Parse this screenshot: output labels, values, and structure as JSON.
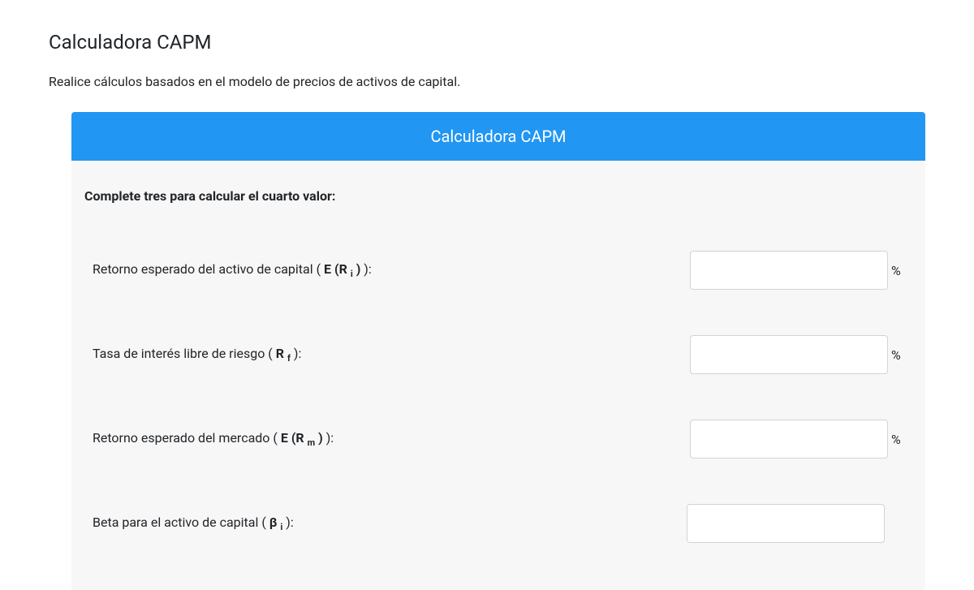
{
  "page": {
    "title": "Calculadora CAPM",
    "description": "Realice cálculos basados en el modelo de precios de activos de capital."
  },
  "panel": {
    "header": "Calculadora CAPM",
    "instruction": "Complete tres para calcular el cuarto valor:"
  },
  "fields": [
    {
      "label_prefix": "Retorno esperado del activo de capital ( ",
      "symbol_main": "E (R ",
      "symbol_sub": "i",
      "symbol_suffix": " )",
      "label_suffix": " ):",
      "value": "",
      "unit": "%"
    },
    {
      "label_prefix": "Tasa de interés libre de riesgo ( ",
      "symbol_main": "R ",
      "symbol_sub": "f",
      "symbol_suffix": "",
      "label_suffix": " ):",
      "value": "",
      "unit": "%"
    },
    {
      "label_prefix": "Retorno esperado del mercado ( ",
      "symbol_main": "E (R ",
      "symbol_sub": "m",
      "symbol_suffix": " )",
      "label_suffix": " ):",
      "value": "",
      "unit": "%"
    },
    {
      "label_prefix": "Beta para el activo de capital ( ",
      "symbol_main": "β ",
      "symbol_sub": "i",
      "symbol_suffix": "",
      "label_suffix": " ):",
      "value": "",
      "unit": ""
    }
  ]
}
